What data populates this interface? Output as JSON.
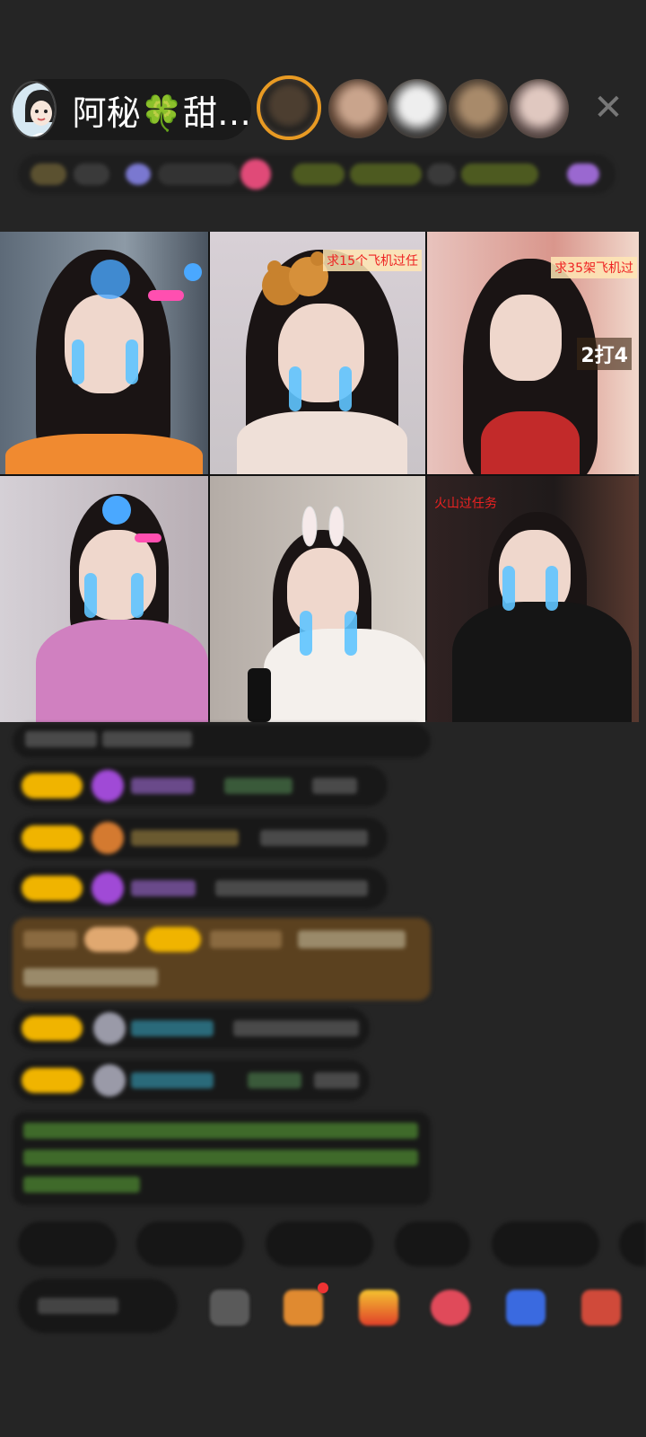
{
  "header": {
    "host_name": "阿秘🍀甜…",
    "host_avatar_icon": "anime-girl-avatar",
    "close_icon": "close-icon"
  },
  "streams": [
    {
      "overlay": ""
    },
    {
      "overlay": "求15个飞机过任"
    },
    {
      "overlay": "求35架飞机过",
      "score": "2打4"
    },
    {
      "overlay": ""
    },
    {
      "overlay": ""
    },
    {
      "overlay": "火山过任务"
    }
  ],
  "colors": {
    "background": "#252525",
    "badge": "#f0b400",
    "accent_green": "#7fd14a",
    "gift_bg": "#6e4b1e",
    "viewer_ring": "#e89a23"
  }
}
